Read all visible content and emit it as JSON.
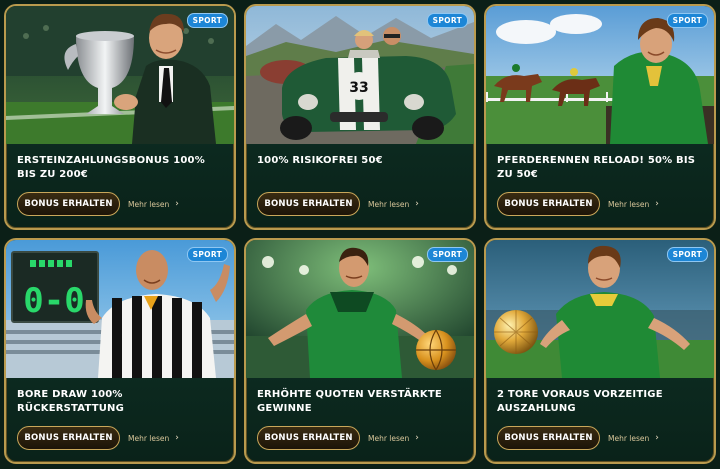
{
  "cards": [
    {
      "badge": "SPORT",
      "title": "ERSTEINZAHLUNGSBONUS 100% BIS ZU 200€",
      "button": "BONUS ERHALTEN",
      "more": "Mehr lesen",
      "image": "football-trophy-man"
    },
    {
      "badge": "SPORT",
      "title": "100% RISIKOFREI 50€",
      "button": "BONUS ERHALTEN",
      "more": "Mehr lesen",
      "image": "racing-car-33"
    },
    {
      "badge": "SPORT",
      "title": "PFERDERENNEN RELOAD! 50% BIS ZU 50€",
      "button": "BONUS ERHALTEN",
      "more": "Mehr lesen",
      "image": "horse-racing"
    },
    {
      "badge": "SPORT",
      "title": "BORE DRAW 100% RÜCKERSTATTUNG",
      "button": "BONUS ERHALTEN",
      "more": "Mehr lesen",
      "image": "referee-scoreboard",
      "scoreboard": "0-0"
    },
    {
      "badge": "SPORT",
      "title": "ERHÖHTE QUOTEN VERSTÄRKTE GEWINNE",
      "button": "BONUS ERHALTEN",
      "more": "Mehr lesen",
      "image": "basketball-player"
    },
    {
      "badge": "SPORT",
      "title": "2 TORE VORAUS VORZEITIGE AUSZAHLUNG",
      "button": "BONUS ERHALTEN",
      "more": "Mehr lesen",
      "image": "football-player-golden-ball"
    }
  ],
  "car_number": "33",
  "colors": {
    "background": "#0b1f17",
    "card_border": "#b99a4e",
    "badge": "#1d86d6",
    "button_border": "#c9a75a"
  }
}
